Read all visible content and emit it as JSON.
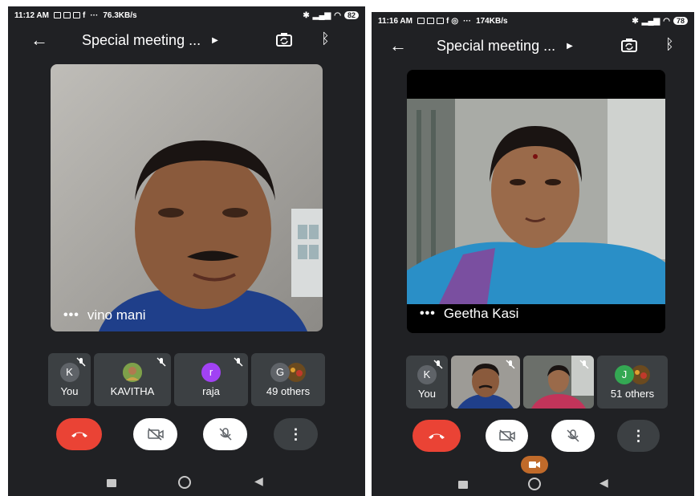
{
  "left": {
    "status": {
      "time": "11:12 AM",
      "more": "···",
      "speed": "76.3KB/s",
      "battery": "82"
    },
    "meeting_title": "Special meeting ...",
    "speaker_name": "vino mani",
    "participants": [
      {
        "initial": "K",
        "label": "You",
        "color": "#5f6368"
      },
      {
        "initial": "",
        "label": "KAVITHA",
        "color": "#6a8f3a"
      },
      {
        "initial": "r",
        "label": "raja",
        "color": "#a142f4"
      },
      {
        "initial": "G",
        "label": "49 others",
        "color": "#5f6368"
      }
    ]
  },
  "right": {
    "status": {
      "time": "11:16 AM",
      "more": "···",
      "speed": "174KB/s",
      "battery": "78"
    },
    "meeting_title": "Special meeting ...",
    "speaker_name": "Geetha Kasi",
    "participants": [
      {
        "initial": "K",
        "label": "You",
        "color": "#5f6368"
      },
      {
        "initial": "J",
        "label": "51 others",
        "color": "#34a853"
      }
    ]
  },
  "icons": {
    "back": "back-arrow-icon",
    "caret": "play-caret-icon",
    "switch_camera": "switch-camera-icon",
    "bluetooth": "bluetooth-icon",
    "end_call": "end-call-icon",
    "camera_off": "camera-off-icon",
    "mic_off": "mic-off-icon",
    "more": "more-vert-icon"
  },
  "colors": {
    "end_call": "#ea4335",
    "background": "#202124",
    "tile": "#3c4043",
    "control": "#3c4043"
  }
}
